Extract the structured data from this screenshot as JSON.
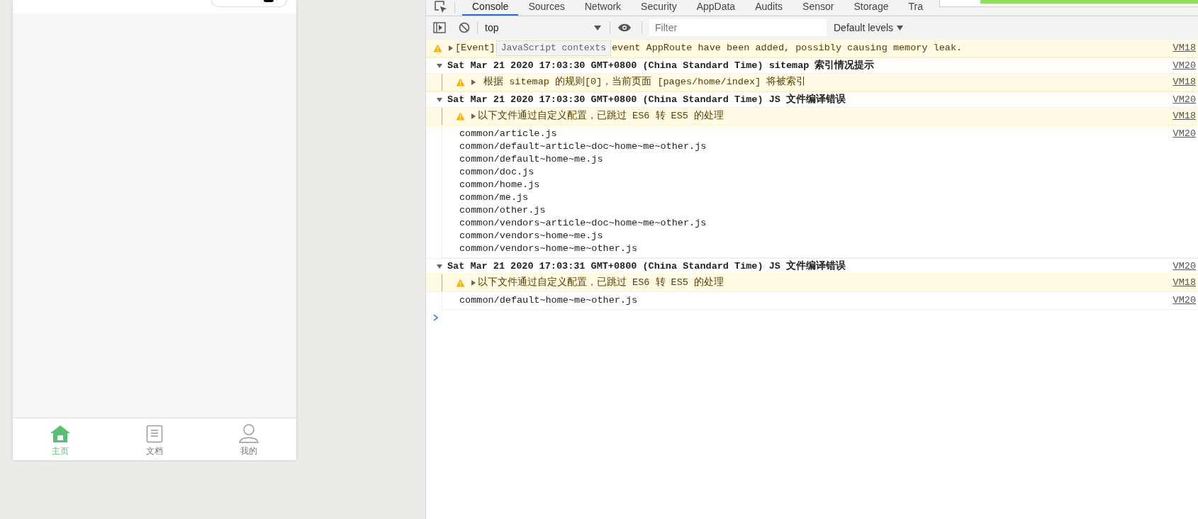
{
  "simulator": {
    "tabbar": [
      {
        "label": "主页",
        "selected": true,
        "kind": "home"
      },
      {
        "label": "文档",
        "selected": false,
        "kind": "doc"
      },
      {
        "label": "我的",
        "selected": false,
        "kind": "user"
      }
    ]
  },
  "devtools": {
    "tabs": [
      {
        "label": "Console",
        "selected": true
      },
      {
        "label": "Sources",
        "selected": false
      },
      {
        "label": "Network",
        "selected": false
      },
      {
        "label": "Security",
        "selected": false
      },
      {
        "label": "AppData",
        "selected": false
      },
      {
        "label": "Audits",
        "selected": false
      },
      {
        "label": "Sensor",
        "selected": false
      },
      {
        "label": "Storage",
        "selected": false
      },
      {
        "label": "Tra",
        "selected": false
      }
    ],
    "toolbar": {
      "context": "top",
      "filter_placeholder": "Filter",
      "levels": "Default levels"
    },
    "progress": {
      "level": 0.84
    },
    "entries": [
      {
        "kind": "covered_warning",
        "text_before": "[Event]",
        "tooltip": "JavaScript contexts",
        "text_after": "event AppRoute have been added, possibly causing memory leak.",
        "source": "VM18"
      },
      {
        "kind": "group",
        "expanded": true,
        "title": "Sat Mar 21 2020 17:03:30 GMT+0800 (China Standard Time) sitemap 索引情况提示",
        "source": "VM20",
        "children": [
          {
            "kind": "warning",
            "text": " 根据 sitemap 的规则[0]，当前页面 [pages/home/index] 将被索引",
            "source": "VM18"
          }
        ]
      },
      {
        "kind": "group",
        "expanded": true,
        "title": "Sat Mar 21 2020 17:03:30 GMT+0800 (China Standard Time) JS 文件编译错误",
        "source": "VM20",
        "children": [
          {
            "kind": "warning",
            "text": "以下文件通过自定义配置，已跳过 ES6 转 ES5 的处理",
            "source": "VM18"
          },
          {
            "kind": "log",
            "source": "VM20",
            "lines": [
              "common/article.js",
              "common/default~article~doc~home~me~other.js",
              "common/default~home~me.js",
              "common/doc.js",
              "common/home.js",
              "common/me.js",
              "common/other.js",
              "common/vendors~article~doc~home~me~other.js",
              "common/vendors~home~me.js",
              "common/vendors~home~me~other.js"
            ]
          }
        ]
      },
      {
        "kind": "group",
        "expanded": true,
        "title": "Sat Mar 21 2020 17:03:31 GMT+0800 (China Standard Time) JS 文件编译错误",
        "source": "VM20",
        "children": [
          {
            "kind": "warning",
            "text": "以下文件通过自定义配置，已跳过 ES6 转 ES5 的处理",
            "source": "VM18"
          },
          {
            "kind": "log",
            "source": "VM20",
            "lines": [
              "common/default~home~me~other.js"
            ]
          }
        ]
      }
    ]
  }
}
